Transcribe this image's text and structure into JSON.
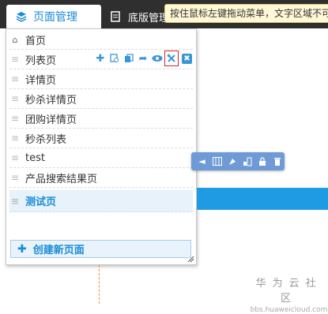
{
  "topbar": {
    "active_tab": "页面管理",
    "inactive_tab": "底版管理",
    "tooltip": "按住鼠标左键拖动菜单，文字区域不可"
  },
  "pages": [
    {
      "label": "首页",
      "type": "home"
    },
    {
      "label": "列表页",
      "type": "hovered"
    },
    {
      "label": "详情页"
    },
    {
      "label": "秒杀详情页"
    },
    {
      "label": "团购详情页"
    },
    {
      "label": "秒杀列表"
    },
    {
      "label": "test"
    },
    {
      "label": "产品搜索结果页"
    },
    {
      "label": "测试页",
      "type": "selected"
    }
  ],
  "row_actions": [
    "add-icon",
    "copy-icon",
    "duplicate-icon",
    "share-icon",
    "preview-icon",
    "settings-icon",
    "delete-icon"
  ],
  "create_button": "创建新页面",
  "canvas_toolbar": [
    "move-icon",
    "grid-icon",
    "style-icon",
    "layout-icon",
    "lock-icon",
    "trash-icon"
  ],
  "watermark": {
    "line1": "华为云社区",
    "line2": "bbs.huaweicloud.com"
  },
  "colors": {
    "accent": "#1a8bd6",
    "topbar": "#2f2f2f",
    "highlight": "#d0222a",
    "toolbar": "#6e9bd6"
  }
}
